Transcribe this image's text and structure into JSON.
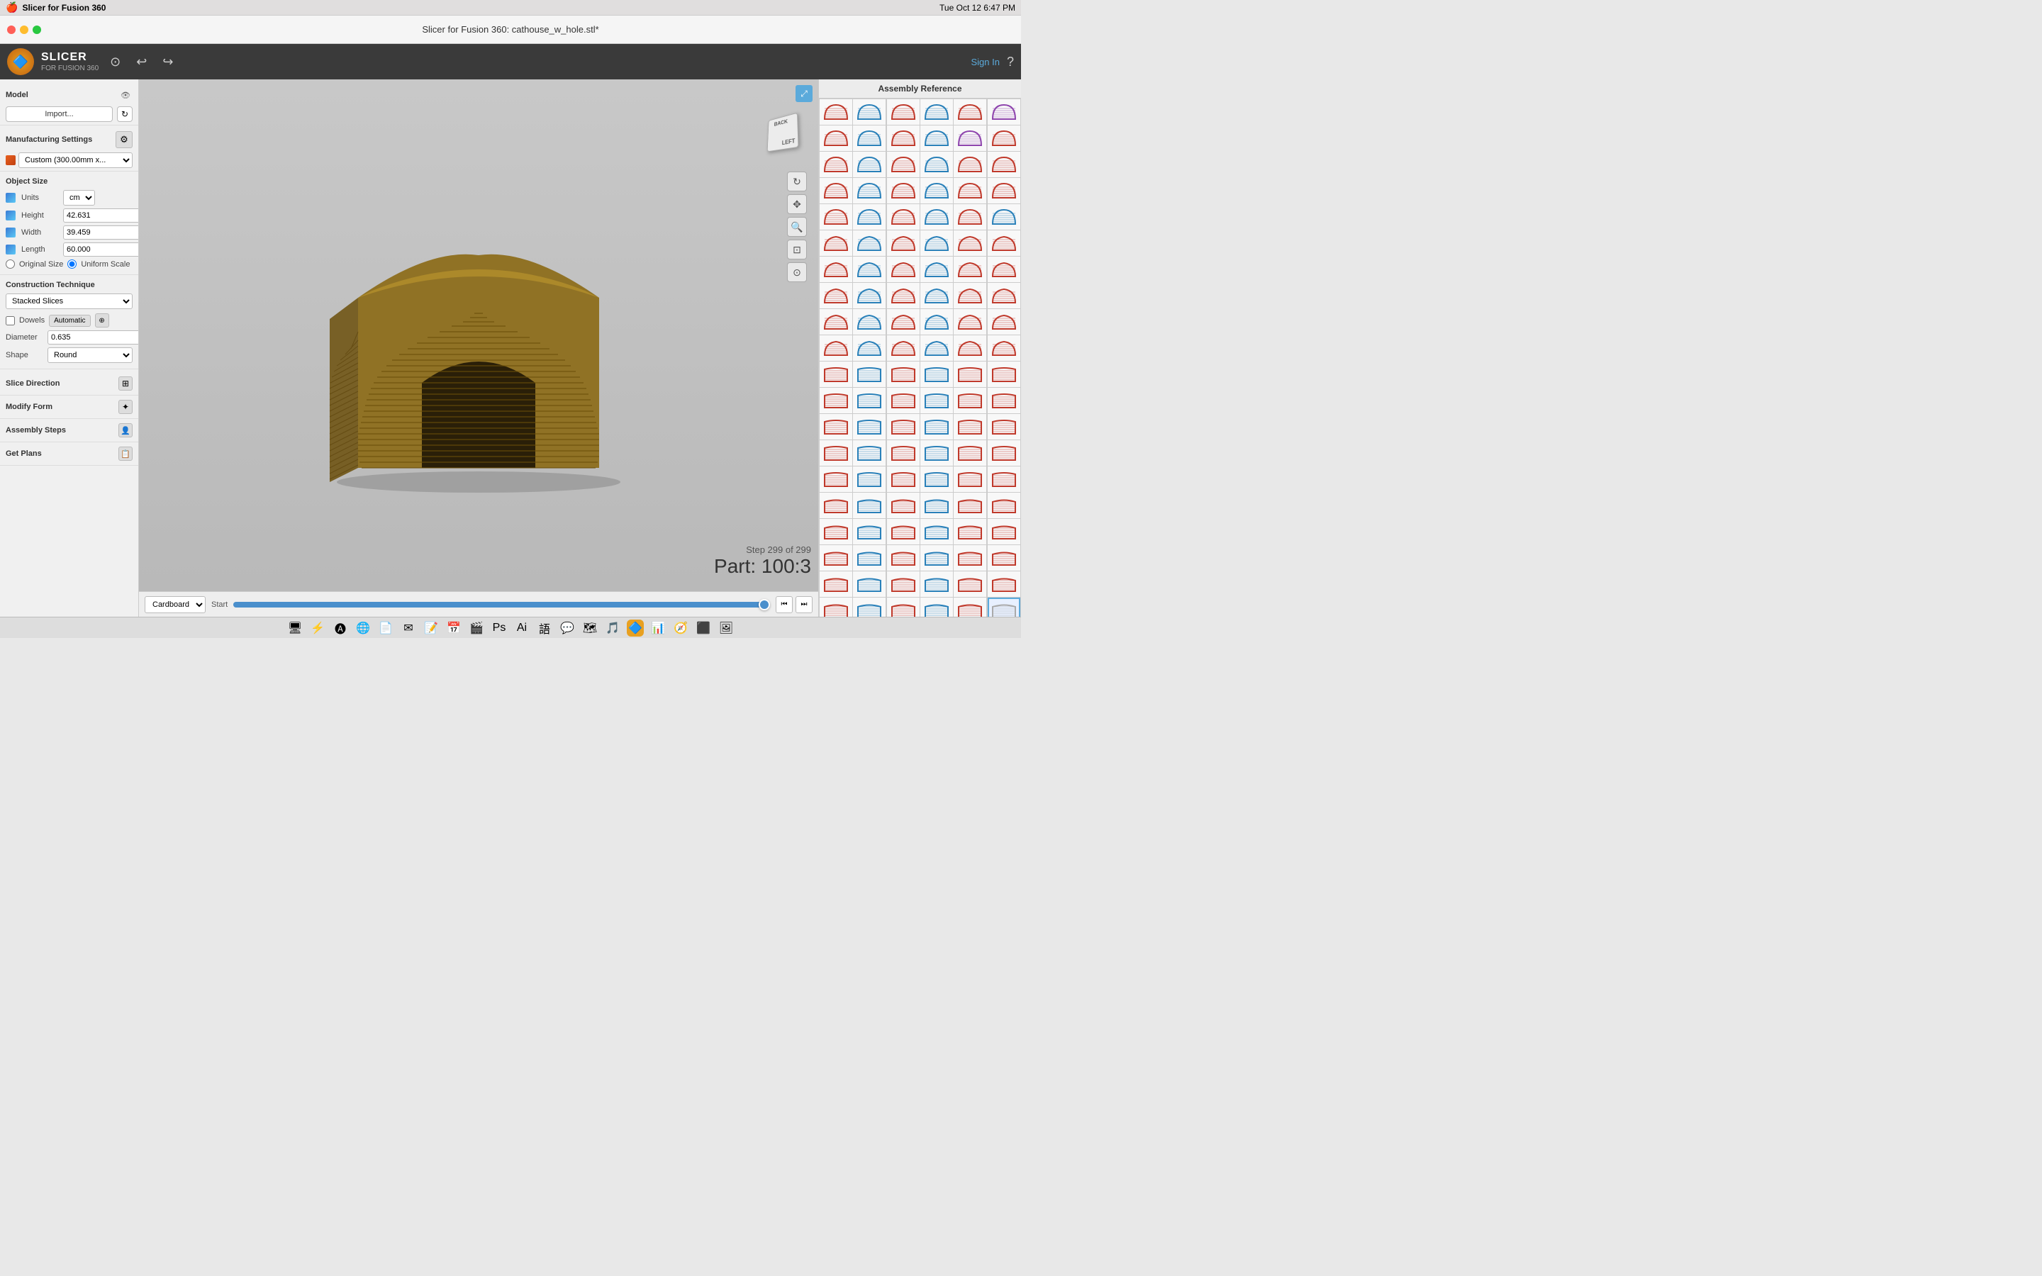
{
  "window": {
    "title": "Slicer for Fusion 360: cathouse_w_hole.stl*",
    "app_name": "Slicer for Fusion 360"
  },
  "menubar": {
    "apple": "🍎",
    "app": "Slicer for Fusion 360",
    "time": "Tue Oct 12  6:47 PM"
  },
  "toolbar": {
    "app_name": "SLICER",
    "app_sub": "FOR FUSION 360",
    "signin": "Sign In",
    "undo": "↩",
    "redo": "↪"
  },
  "sidebar": {
    "model_label": "Model",
    "import_btn": "Import...",
    "manufacturing_settings_label": "Manufacturing Settings",
    "custom_preset": "Custom (300.00mm x...",
    "object_size_label": "Object Size",
    "units_label": "Units",
    "units_value": "cm",
    "height_label": "Height",
    "height_value": "42.631",
    "width_label": "Width",
    "width_value": "39.459",
    "length_label": "Length",
    "length_value": "60.000",
    "original_size_label": "Original Size",
    "uniform_scale_label": "Uniform Scale",
    "construction_technique_label": "Construction Technique",
    "technique_value": "Stacked Slices",
    "dowels_label": "Dowels",
    "automatic_label": "Automatic",
    "diameter_label": "Diameter",
    "diameter_value": "0.635",
    "shape_label": "Shape",
    "shape_value": "Round",
    "slice_direction_label": "Slice Direction",
    "modify_form_label": "Modify Form",
    "assembly_steps_label": "Assembly Steps",
    "get_plans_label": "Get Plans"
  },
  "viewport": {
    "step_label": "Step 299 of 299",
    "part_label": "Part: 100:3",
    "timeline_start": "Start",
    "material": "Cardboard"
  },
  "assembly_panel": {
    "title": "Assembly Reference",
    "grid_rows": 20,
    "grid_cols": 6
  },
  "colors": {
    "accent": "#5BAADB",
    "sidebar_bg": "#f0f0f0",
    "toolbar_bg": "#3a3a3a",
    "viewport_bg": "#c0c0c0"
  }
}
